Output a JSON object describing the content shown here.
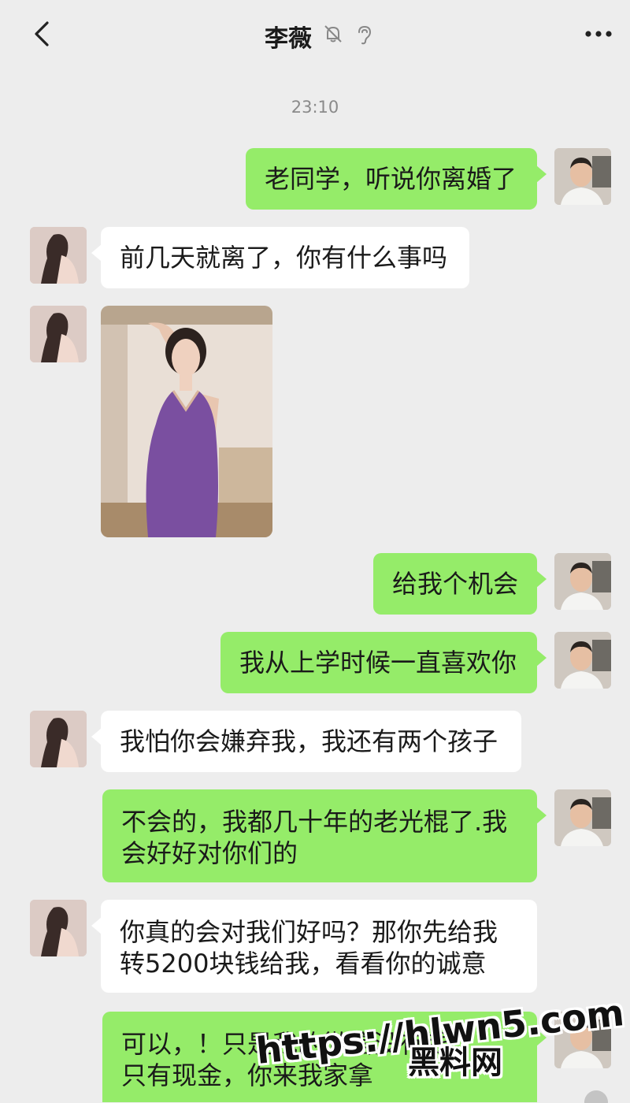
{
  "header": {
    "contact_name": "李薇",
    "back_icon": "chevron-left-icon",
    "mute_icon": "bell-off-icon",
    "ear_icon": "ear-icon",
    "more_icon": "more-dots-icon"
  },
  "timestamp": "23:10",
  "messages": [
    {
      "side": "right",
      "kind": "text",
      "lines": [
        "老同学，听说你离婚了"
      ]
    },
    {
      "side": "left",
      "kind": "text",
      "lines": [
        "前几天就离了，你有什么事吗"
      ]
    },
    {
      "side": "left",
      "kind": "image"
    },
    {
      "side": "right",
      "kind": "text",
      "lines": [
        "给我个机会"
      ]
    },
    {
      "side": "right",
      "kind": "text",
      "lines": [
        "我从上学时候一直喜欢你"
      ]
    },
    {
      "side": "left",
      "kind": "text",
      "lines": [
        "我怕你会嫌弃我，我还有两个孩子"
      ]
    },
    {
      "side": "right",
      "kind": "text",
      "lines": [
        "不会的，我都几十年的老光棍了.我",
        "会好好对你们的"
      ]
    },
    {
      "side": "left",
      "kind": "text",
      "lines": [
        "你真的会对我们好吗？那你先给我",
        "转5200块钱给我，看看你的诚意"
      ]
    },
    {
      "side": "right",
      "kind": "text",
      "lines": [
        "可以，！只是我的微信没有钱",
        "只有现金，你来我家拿"
      ]
    }
  ],
  "watermark": {
    "url": "https://hlwn5.com",
    "label": "黑料网"
  },
  "colors": {
    "background": "#ededed",
    "my_bubble": "#95ec69",
    "their_bubble": "#ffffff"
  }
}
